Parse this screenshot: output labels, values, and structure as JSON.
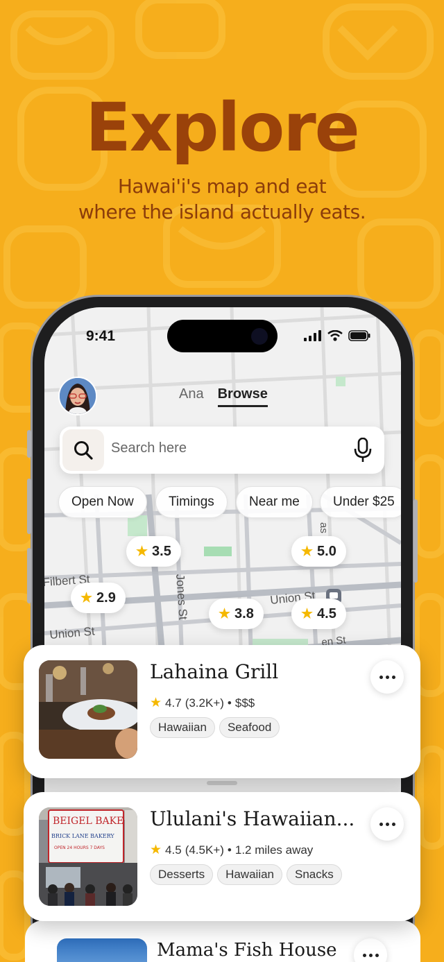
{
  "hero": {
    "title": "Explore",
    "subtitle_line1": "Hawai'i's map and eat",
    "subtitle_line2": "where the island actually eats."
  },
  "status_bar": {
    "time": "9:41"
  },
  "header": {
    "tabs": [
      {
        "label": "Ana",
        "active": false
      },
      {
        "label": "Browse",
        "active": true
      }
    ]
  },
  "search": {
    "placeholder": "Search here"
  },
  "filters": [
    "Open Now",
    "Timings",
    "Near me",
    "Under $25"
  ],
  "map": {
    "street_labels": [
      "Filbert St",
      "Jones St",
      "Union St",
      "Union St",
      "as",
      "en St"
    ],
    "ratings": [
      "3.5",
      "5.0",
      "2.9",
      "3.8",
      "4.5"
    ]
  },
  "restaurants": [
    {
      "name": "Lahaina Grill",
      "rating": "4.7",
      "reviews": "(3.2K+)",
      "extra": "$$$",
      "tags": [
        "Hawaiian",
        "Seafood"
      ]
    },
    {
      "name": "Ululani's Hawaiian...",
      "rating": "4.5",
      "reviews": "(4.5K+)",
      "extra": "1.2 miles away",
      "tags": [
        "Desserts",
        "Hawaiian",
        "Snacks"
      ],
      "sign_text": [
        "BEIGEL BAKE",
        "BRICK LANE BAKERY",
        "OPEN 24 HOURS 7 DAYS"
      ]
    },
    {
      "name": "Mama's Fish House"
    }
  ],
  "colors": {
    "background": "#f6ae1c",
    "hero_title": "#9a420a",
    "star": "#f5b800"
  }
}
